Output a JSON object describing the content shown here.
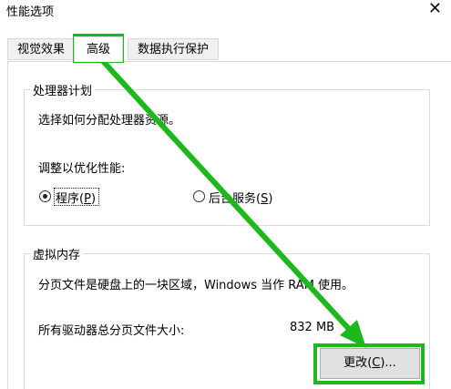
{
  "window": {
    "title": "性能选项",
    "close_glyph": "✕"
  },
  "tabs": [
    {
      "label": "视觉效果"
    },
    {
      "label": "高级"
    },
    {
      "label": "数据执行保护"
    }
  ],
  "processor": {
    "legend": "处理器计划",
    "description": "选择如何分配处理器资源。",
    "adjust_label": "调整以优化性能:",
    "options": [
      {
        "label": "程序",
        "accel": "P",
        "selected": true
      },
      {
        "label": "后台服务",
        "accel": "S",
        "selected": false
      }
    ]
  },
  "virtual_memory": {
    "legend": "虚拟内存",
    "description": "分页文件是硬盘上的一块区域，Windows 当作 RAM 使用。",
    "total_label": "所有驱动器总分页文件大小:",
    "total_value": "832 MB",
    "change_button": {
      "label": "更改",
      "accel": "C",
      "suffix": "..."
    }
  },
  "annotation": {
    "color": "#1cb81c"
  }
}
